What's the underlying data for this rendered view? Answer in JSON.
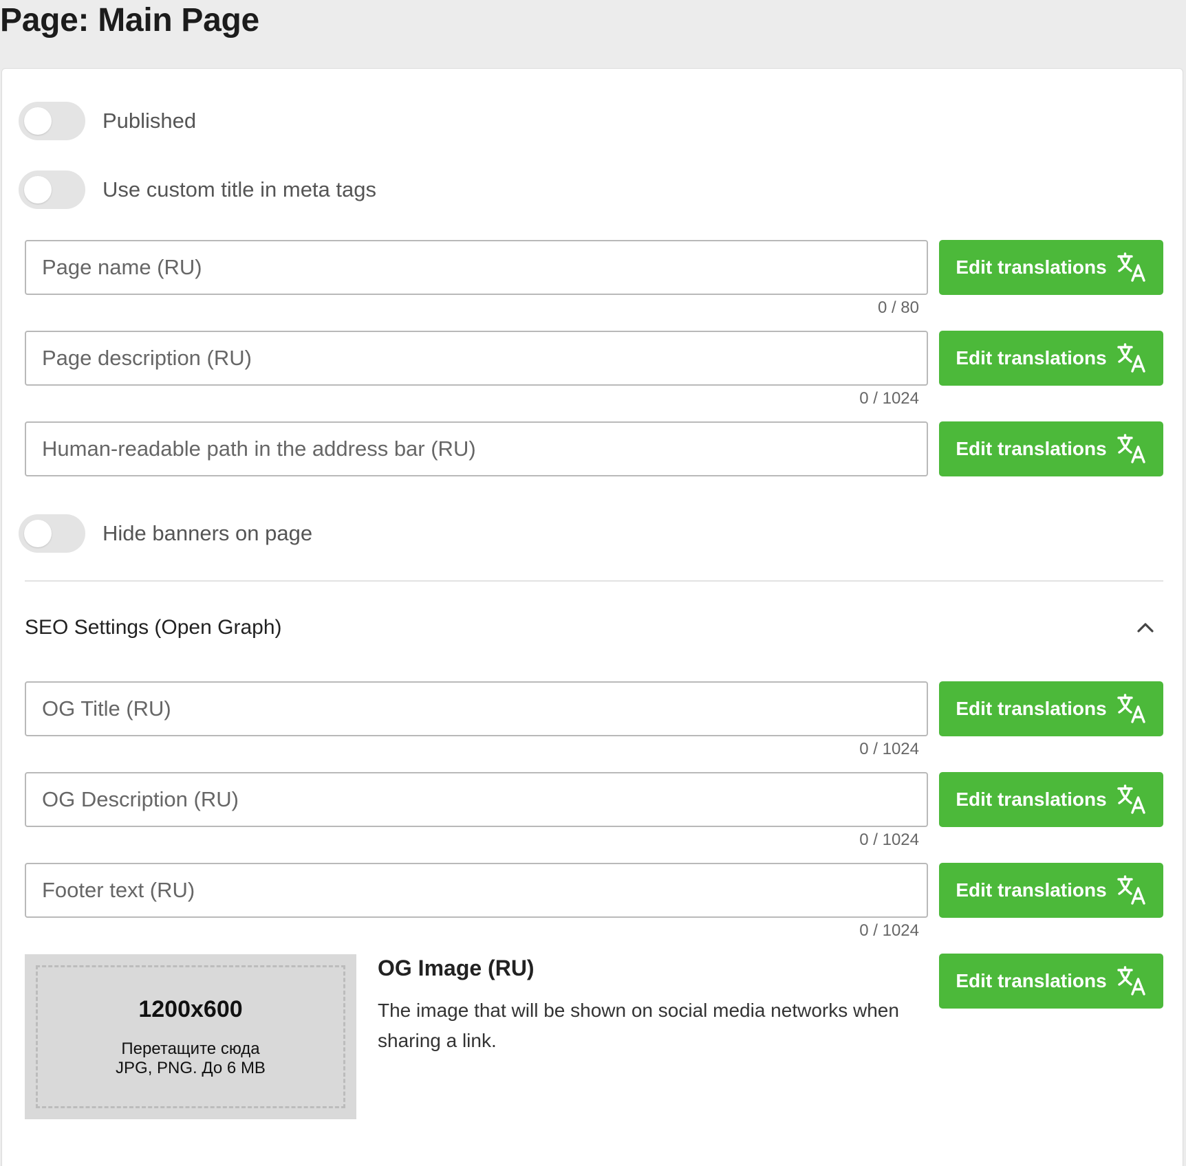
{
  "header": {
    "title": "Page: Main Page"
  },
  "toggles": {
    "published": {
      "label": "Published",
      "on": false
    },
    "custom_title": {
      "label": "Use custom title in meta tags",
      "on": false
    },
    "hide_banners": {
      "label": "Hide banners on page",
      "on": false
    }
  },
  "fields": {
    "page_name": {
      "placeholder": "Page name (RU)",
      "value": "",
      "counter": "0 / 80"
    },
    "page_description": {
      "placeholder": "Page description (RU)",
      "value": "",
      "counter": "0 / 1024"
    },
    "path": {
      "placeholder": "Human-readable path in the address bar (RU)",
      "value": ""
    },
    "og_title": {
      "placeholder": "OG Title (RU)",
      "value": "",
      "counter": "0 / 1024"
    },
    "og_description": {
      "placeholder": "OG Description (RU)",
      "value": "",
      "counter": "0 / 1024"
    },
    "footer_text": {
      "placeholder": "Footer text (RU)",
      "value": "",
      "counter": "0 / 1024"
    }
  },
  "buttons": {
    "edit_translations": "Edit translations",
    "icon": "translate-icon"
  },
  "seo": {
    "title": "SEO Settings (Open Graph)",
    "expanded": true,
    "icon": "chevron-up-icon"
  },
  "og_image": {
    "title": "OG Image (RU)",
    "description": "The image that will be shown on social media networks when sharing a link.",
    "dropzone": {
      "size": "1200x600",
      "hint_line1": "Перетащите сюда",
      "hint_line2": "JPG, PNG. До 6 MB"
    }
  },
  "colors": {
    "accent": "#4cb93a",
    "background": "#ececec",
    "toggle_off": "#e4e4e4"
  }
}
